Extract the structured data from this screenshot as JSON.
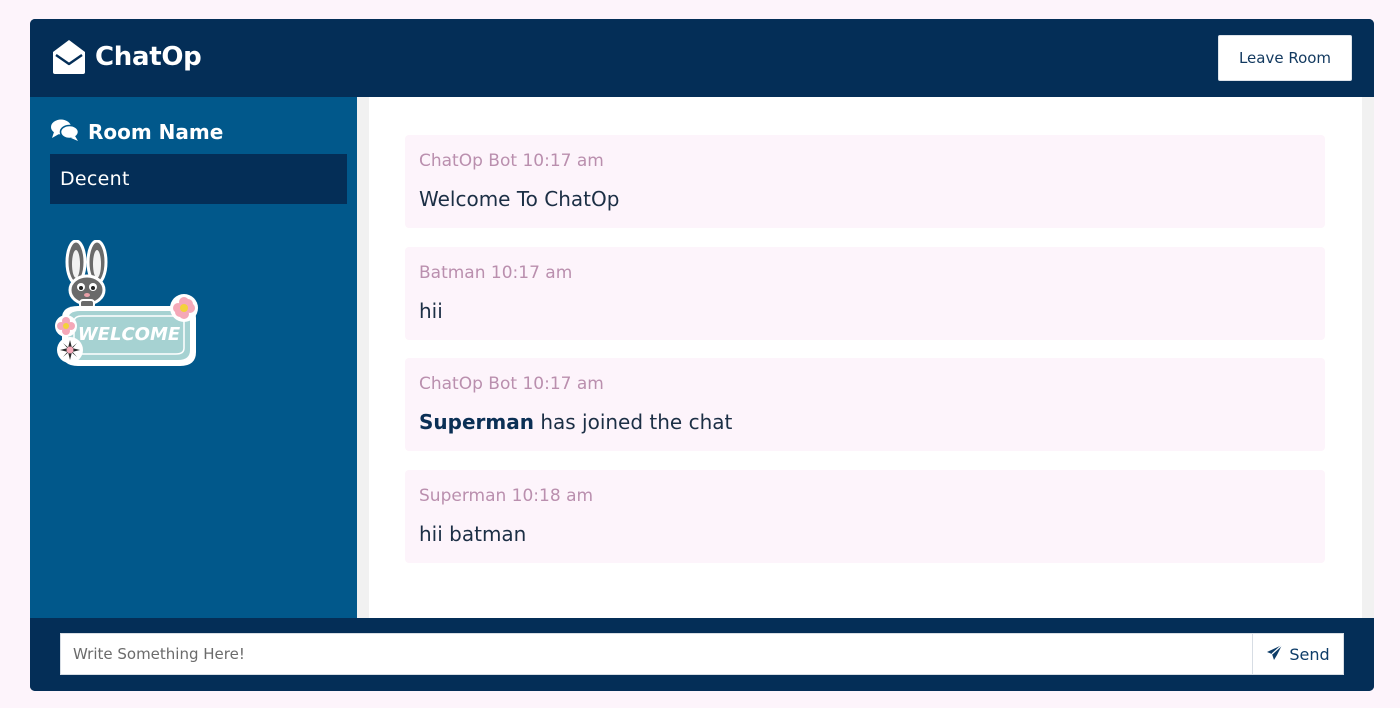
{
  "header": {
    "title": "ChatOp",
    "leave_button": "Leave Room"
  },
  "sidebar": {
    "heading": "Room Name",
    "room_name": "Decent",
    "sticker_text": "WELCOME"
  },
  "messages": [
    {
      "author": "ChatOp Bot",
      "time": "10:17 am",
      "text": "Welcome To ChatOp"
    },
    {
      "author": "Batman",
      "time": "10:17 am",
      "text": "hii"
    },
    {
      "author": "ChatOp Bot",
      "time": "10:17 am",
      "bold_name": "Superman",
      "text": " has joined the chat"
    },
    {
      "author": "Superman",
      "time": "10:18 am",
      "text": "hii batman"
    }
  ],
  "composer": {
    "placeholder": "Write Something Here!",
    "send_label": "Send"
  },
  "colors": {
    "navy": "#042e57",
    "sidebar_blue": "#01588b",
    "message_bg": "#fdf4fb",
    "meta_pink": "#ba8fae"
  },
  "icons": {
    "logo": "envelope-open-icon",
    "room": "chat-bubbles-icon",
    "send": "paper-plane-icon"
  }
}
